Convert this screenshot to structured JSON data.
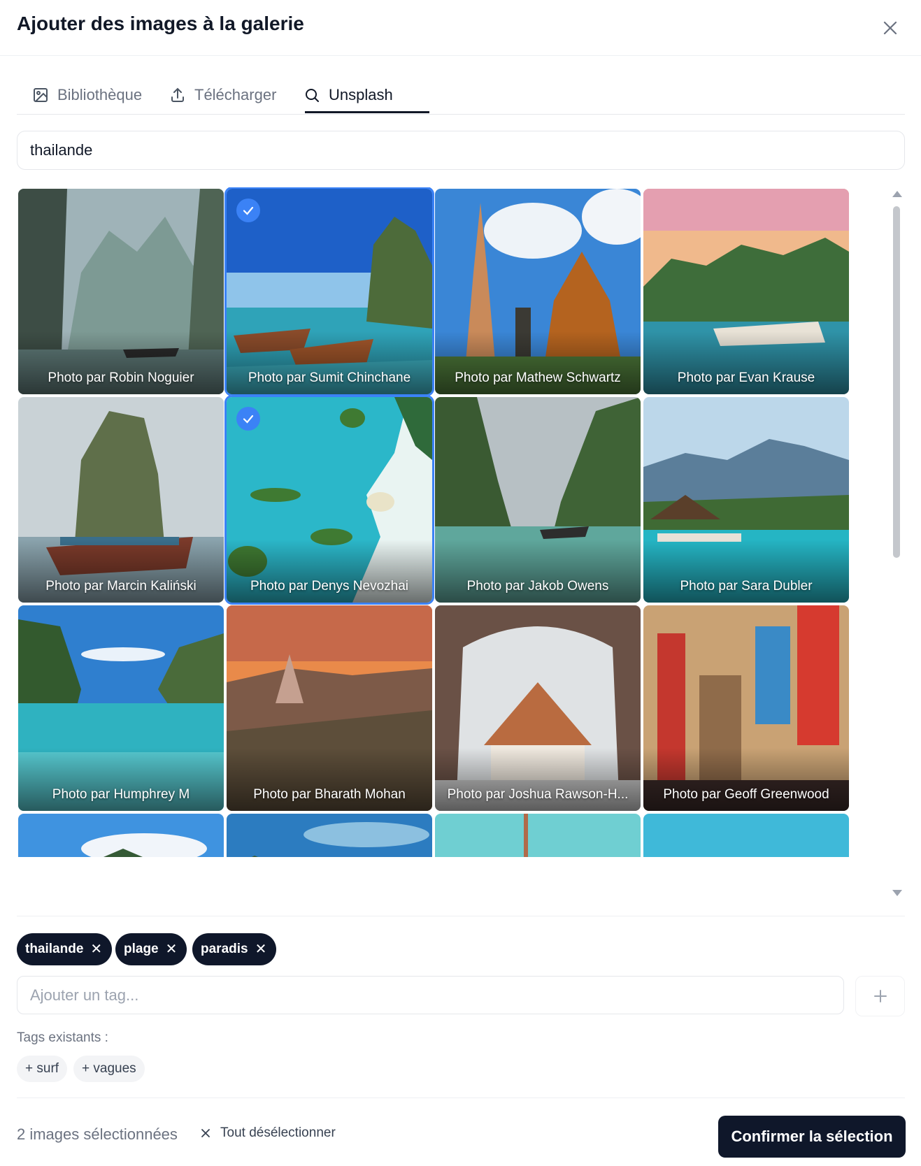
{
  "dialog": {
    "title": "Ajouter des images à la galerie",
    "close_icon": "close-icon"
  },
  "tabs": [
    {
      "label": "Bibliothèque",
      "icon": "image-icon",
      "active": false
    },
    {
      "label": "Télécharger",
      "icon": "upload-icon",
      "active": false
    },
    {
      "label": "Unsplash",
      "icon": "search-icon",
      "active": true
    }
  ],
  "search": {
    "value": "thailande"
  },
  "photos": [
    {
      "caption": "Photo par Robin Noguier",
      "selected": false
    },
    {
      "caption": "Photo par Sumit Chinchane",
      "selected": true
    },
    {
      "caption": "Photo par Mathew Schwartz",
      "selected": false
    },
    {
      "caption": "Photo par Evan Krause",
      "selected": false
    },
    {
      "caption": "Photo par Marcin Kaliński",
      "selected": false
    },
    {
      "caption": "Photo par Denys Nevozhai",
      "selected": true
    },
    {
      "caption": "Photo par Jakob Owens",
      "selected": false
    },
    {
      "caption": "Photo par Sara Dubler",
      "selected": false
    },
    {
      "caption": "Photo par Humphrey M",
      "selected": false
    },
    {
      "caption": "Photo par Bharath Mohan",
      "selected": false
    },
    {
      "caption": "Photo par Joshua Rawson-H...",
      "selected": false
    },
    {
      "caption": "Photo par Geoff Greenwood",
      "selected": false
    }
  ],
  "tags": {
    "applied": [
      "thailande",
      "plage",
      "paradis"
    ],
    "input_placeholder": "Ajouter un tag...",
    "existing_label": "Tags existants :",
    "existing": [
      "+ surf",
      "+ vagues"
    ]
  },
  "footer": {
    "selected_count": "2 images sélectionnées",
    "deselect_label": "Tout désélectionner",
    "confirm_label": "Confirmer la sélection"
  },
  "colors": {
    "accent": "#3b82f6",
    "primary_dark": "#0f172a"
  }
}
